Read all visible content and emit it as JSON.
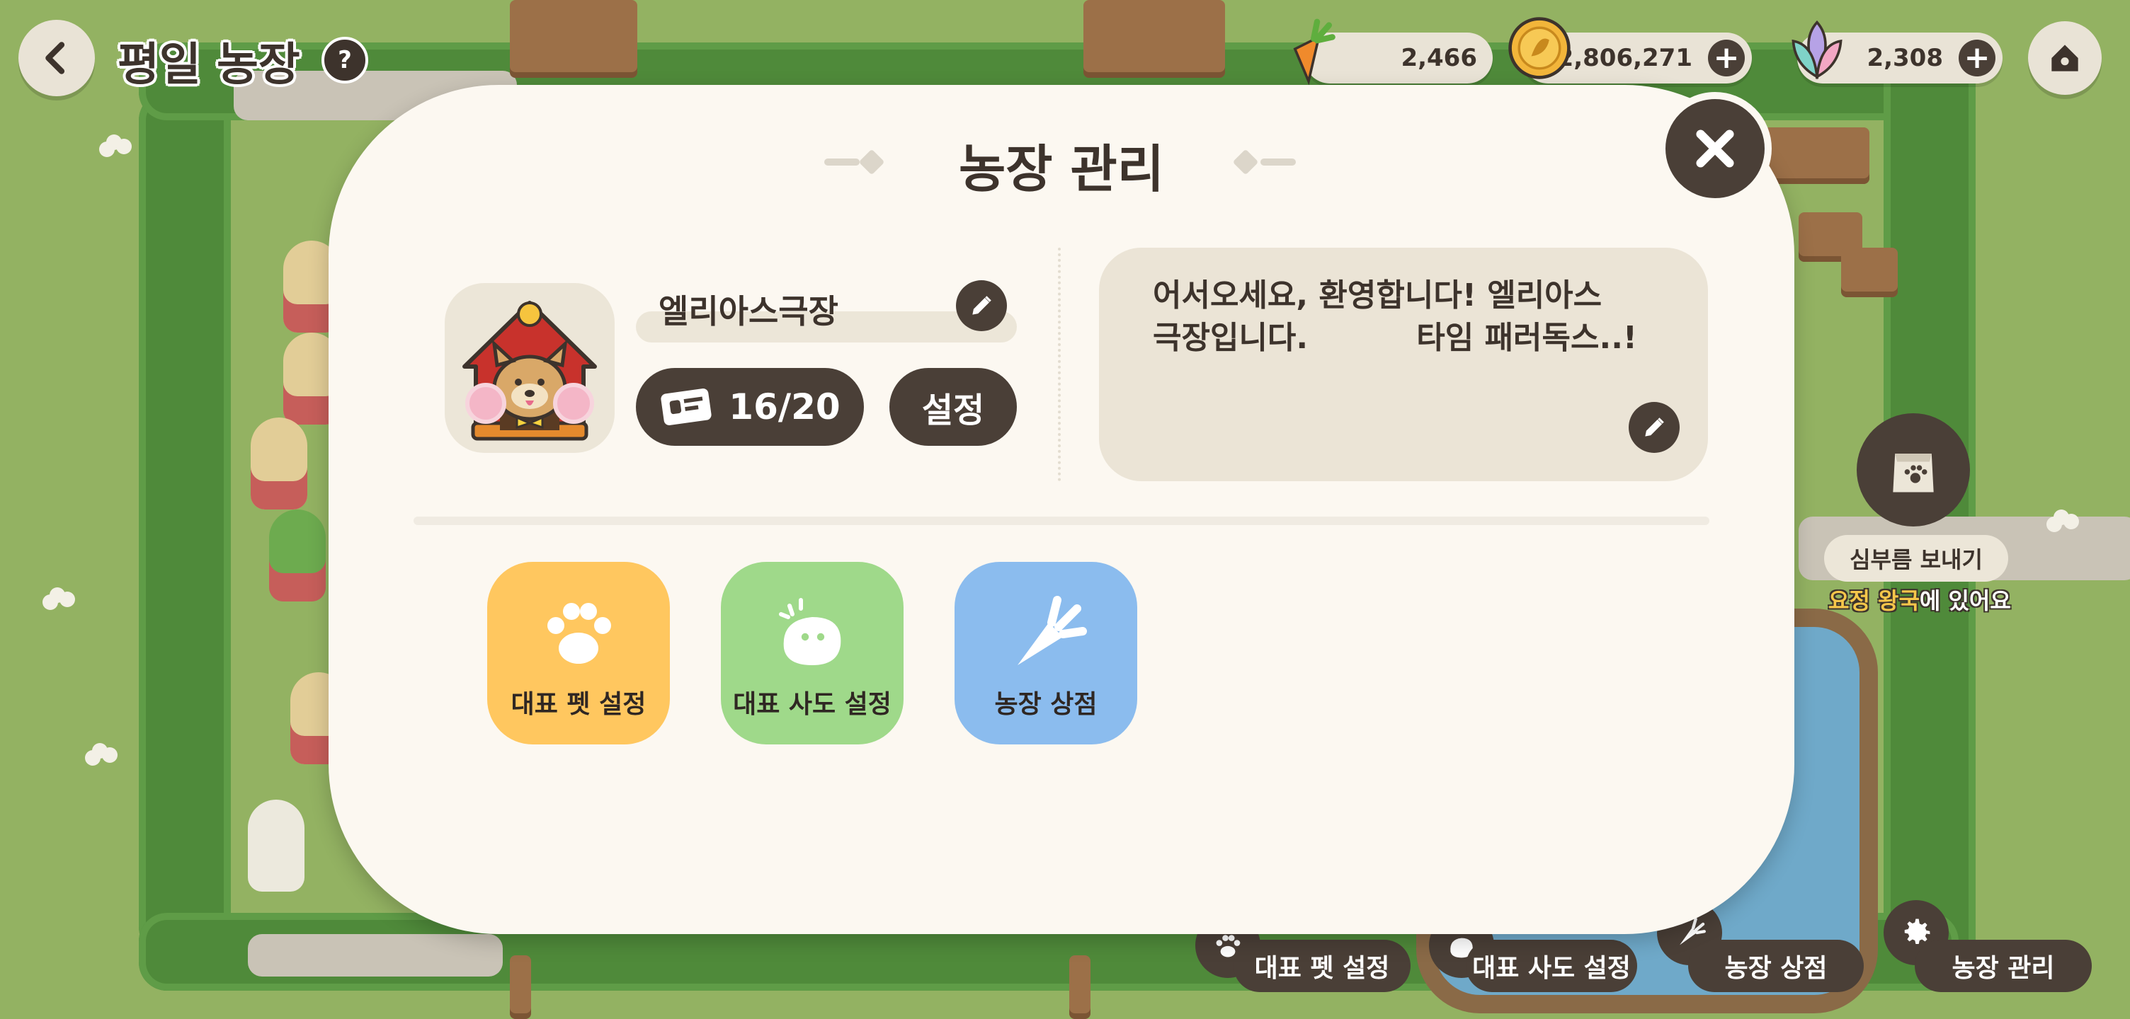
{
  "header": {
    "farm_name": "평일 농장",
    "help_badge": "?",
    "back_icon": "chevron-left-icon",
    "home_icon": "home-icon"
  },
  "currencies": [
    {
      "name": "carrot",
      "icon": "carrot-icon",
      "value": "2,466",
      "has_plus": false
    },
    {
      "name": "gold-coin",
      "icon": "coin-icon",
      "value": "2,806,271",
      "has_plus": true
    },
    {
      "name": "gem",
      "icon": "leaf-gem-icon",
      "value": "2,308",
      "has_plus": true
    }
  ],
  "modal": {
    "title": "농장 관리",
    "profile": {
      "name": "엘리아스극장",
      "visitors": "16/20",
      "settings_label": "설정"
    },
    "greeting": "어서오세요, 환영합니다! 엘리아스\n극장입니다.          타임 패러독스..!",
    "tiles": [
      {
        "label": "대표 펫 설정",
        "icon": "paw-icon",
        "color": "#ffc75f"
      },
      {
        "label": "대표 사도 설정",
        "icon": "blob-icon",
        "color": "#9fd98a"
      },
      {
        "label": "농장 상점",
        "icon": "carrot-icon",
        "color": "#8bbcee"
      }
    ]
  },
  "side": {
    "errand_button": "심부름 보내기",
    "status_highlight": "요정 왕국",
    "status_suffix": "에 있어요"
  },
  "bottom_bar": [
    {
      "label": "대표 펫 설정",
      "icon": "paw-icon"
    },
    {
      "label": "대표 사도 설정",
      "icon": "blob-icon"
    },
    {
      "label": "농장 상점",
      "icon": "carrot-icon"
    },
    {
      "label": "농장 관리",
      "icon": "gear-icon"
    }
  ],
  "colors": {
    "dark": "#4a3f37",
    "panel": "#fcf8f1",
    "accent_yellow": "#ffc75f",
    "accent_green": "#9fd98a",
    "accent_blue": "#8bbcee"
  }
}
